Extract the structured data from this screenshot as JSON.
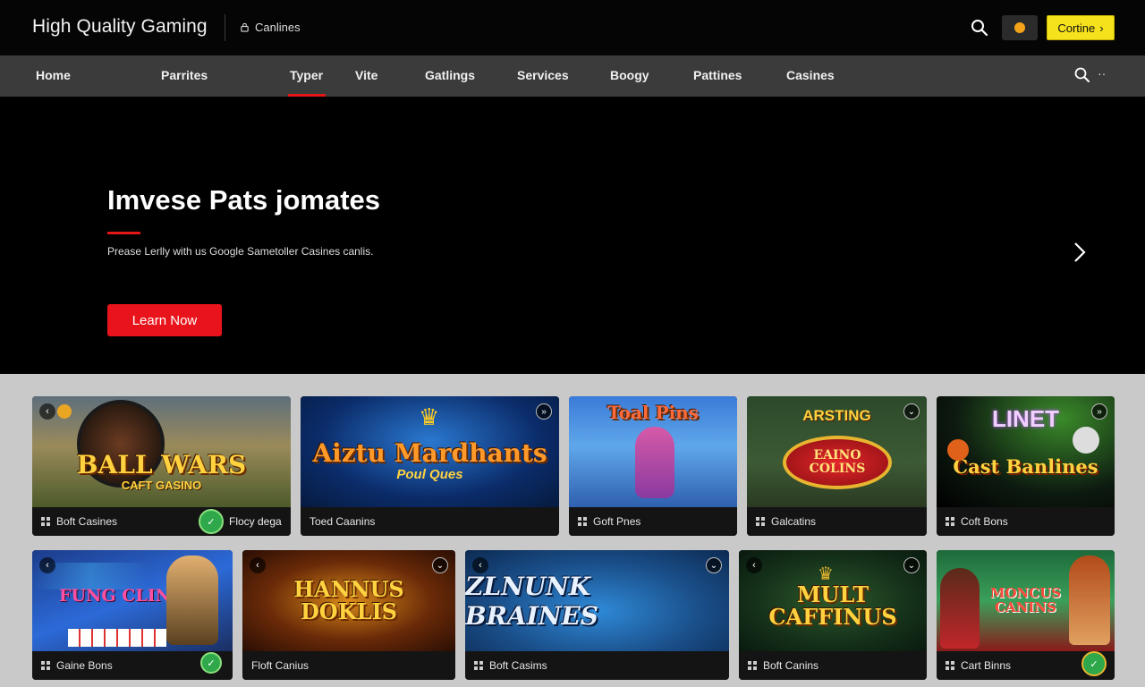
{
  "topbar": {
    "brand": "High Quality Gaming",
    "link_label": "Canlines",
    "continue_label": "Cortine"
  },
  "nav": {
    "items": [
      "Home",
      "Parrites",
      "Typer",
      "Vite",
      "Gatlings",
      "Services",
      "Boogy",
      "Pattines",
      "Casines"
    ],
    "active_index": 2,
    "more_label": "··"
  },
  "hero": {
    "title": "Imvese Pats jomates",
    "subtitle": "Prease Lerlly with us Google Sametoller Casines canlis.",
    "cta_label": "Learn Now"
  },
  "colors": {
    "accent_red": "#e51616",
    "cta_yellow": "#f6e21c",
    "nav_bg": "#3b3b3b",
    "games_bg": "#c9c9c9"
  },
  "games": {
    "row1": [
      {
        "art": "BALL WARS",
        "art_sub": "CAFT GASINO",
        "label": "Boft Casines",
        "badge_label": "Flocy dega"
      },
      {
        "art": "Aiztu Mardhants",
        "art_sub": "Poul Ques",
        "label": "Toed Caanins"
      },
      {
        "art": "Toal Pins",
        "art_sub": "",
        "label": "Goft Pnes"
      },
      {
        "art": "ARSTING",
        "art_sub": "EAINO COLINS",
        "label": "Galcatins"
      },
      {
        "art": "LINET",
        "art_sub": "Cast Banlines",
        "label": "Coft Bons"
      }
    ],
    "row2": [
      {
        "art": "FUNG CLINS",
        "art_sub": "",
        "label": "Gaine Bons"
      },
      {
        "art": "HANNUS DOKLIS",
        "art_sub": "",
        "label": "Floft Canius"
      },
      {
        "art": "ZLNUNK BRAINES",
        "art_sub": "",
        "label": "Boft Casims"
      },
      {
        "art": "MULT CAFFINUS",
        "art_sub": "",
        "label": "Boft Canins"
      },
      {
        "art": "MONCUS CANINS",
        "art_sub": "",
        "label": "Cart Binns"
      }
    ]
  }
}
